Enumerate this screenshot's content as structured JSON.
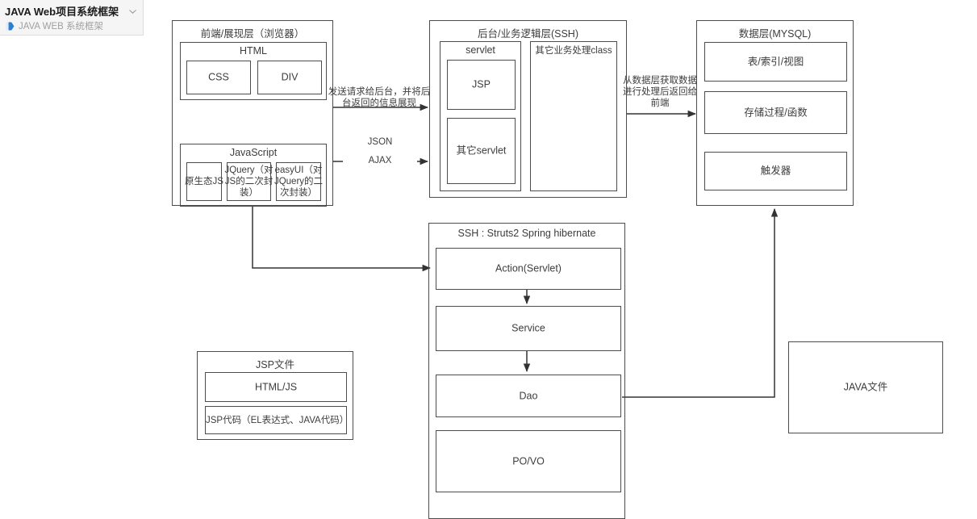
{
  "header": {
    "title": "JAVA Web项目系统框架",
    "chevron_icon": "chevron-down-icon",
    "tag_icon": "tag-icon",
    "subtitle": "JAVA WEB 系统框架"
  },
  "diagram": {
    "frontend": {
      "title": "前端/展现层（浏览器）",
      "html_group": {
        "title": "HTML",
        "items": [
          {
            "label": "CSS"
          },
          {
            "label": "DIV"
          }
        ]
      },
      "js_group": {
        "title": "JavaScript",
        "items": [
          {
            "label": "原生态JS"
          },
          {
            "label": "JQuery（对JS的二次封装）"
          },
          {
            "label": "easyUI（对JQuery的二次封装）"
          }
        ]
      }
    },
    "backend": {
      "title": "后台/业务逻辑层(SSH)",
      "servlet_group": {
        "title": "servlet",
        "items": [
          {
            "label": "JSP"
          },
          {
            "label": "其它servlet"
          }
        ]
      },
      "other_class": {
        "label": "其它业务处理class"
      }
    },
    "datalayer": {
      "title": "数据层(MYSQL)",
      "items": [
        {
          "label": "表/索引/视图"
        },
        {
          "label": "存储过程/函数"
        },
        {
          "label": "触发器"
        }
      ]
    },
    "ssh": {
      "title": "SSH : Struts2 Spring hibernate",
      "items": [
        {
          "label": "Action(Servlet)"
        },
        {
          "label": "Service"
        },
        {
          "label": "Dao"
        },
        {
          "label": "PO/VO"
        }
      ]
    },
    "jsp_file": {
      "title": "JSP文件",
      "items": [
        {
          "label": "HTML/JS"
        },
        {
          "label": "JSP代码（EL表达式、JAVA代码）"
        }
      ]
    },
    "java_file": {
      "label": "JAVA文件"
    },
    "edges": [
      {
        "label": "发送请求给后台，并将后台返回的信息展现"
      },
      {
        "label": "JSON"
      },
      {
        "label": "AJAX"
      },
      {
        "label": "从数据层获取数据进行处理后返回给前端"
      }
    ]
  },
  "colors": {
    "stroke": "#4d4d4d",
    "text": "#3d3d3d",
    "panel_bg": "#f5f5f5",
    "panel_border": "#dddddd",
    "accent": "#2f7fd1",
    "muted_text": "#a0a0a0"
  }
}
